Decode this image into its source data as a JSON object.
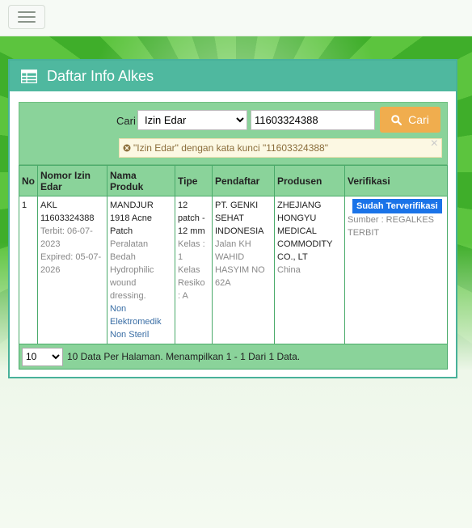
{
  "panel": {
    "title": "Daftar Info Alkes"
  },
  "search": {
    "label": "Cari",
    "field_selected": "Izin Edar",
    "keyword": "11603324388",
    "button_label": "Cari",
    "filter_text": "\"Izin Edar\" dengan kata kunci \"11603324388\""
  },
  "table": {
    "headers": [
      "No",
      "Nomor Izin Edar",
      "Nama Produk",
      "Tipe",
      "Pendaftar",
      "Produsen",
      "Verifikasi"
    ],
    "rows": [
      {
        "no": "1",
        "nomor": "AKL 11603324388",
        "terbit": "Terbit: 06-07-2023",
        "expired": "Expired: 05-07-2026",
        "produk": "MANDJUR 1918 Acne Patch",
        "produk_desc": "Peralatan Bedah Hydrophilic wound dressing.",
        "produk_kategori": "Non Elektromedik Non Steril",
        "tipe": "12 patch - 12 mm",
        "kelas": "Kelas : 1",
        "resiko": "Kelas Resiko : A",
        "pendaftar": "PT. GENKI SEHAT INDONESIA",
        "alamat": "Jalan KH WAHID HASYIM NO 62A",
        "produsen": "ZHEJIANG HONGYU MEDICAL COMMODITY CO., LT",
        "negara": "China",
        "status": "Sudah Terverifikasi",
        "sumber": "Sumber : REGALKES TERBIT"
      }
    ]
  },
  "pagination": {
    "per_page": "10",
    "summary": "10 Data Per Halaman. Menampilkan 1 - 1 Dari 1 Data."
  },
  "colors": {
    "accent": "#4fb89f",
    "search_button": "#f0ad4e",
    "badge": "#1a73e8",
    "table_header": "#8ad39a"
  }
}
